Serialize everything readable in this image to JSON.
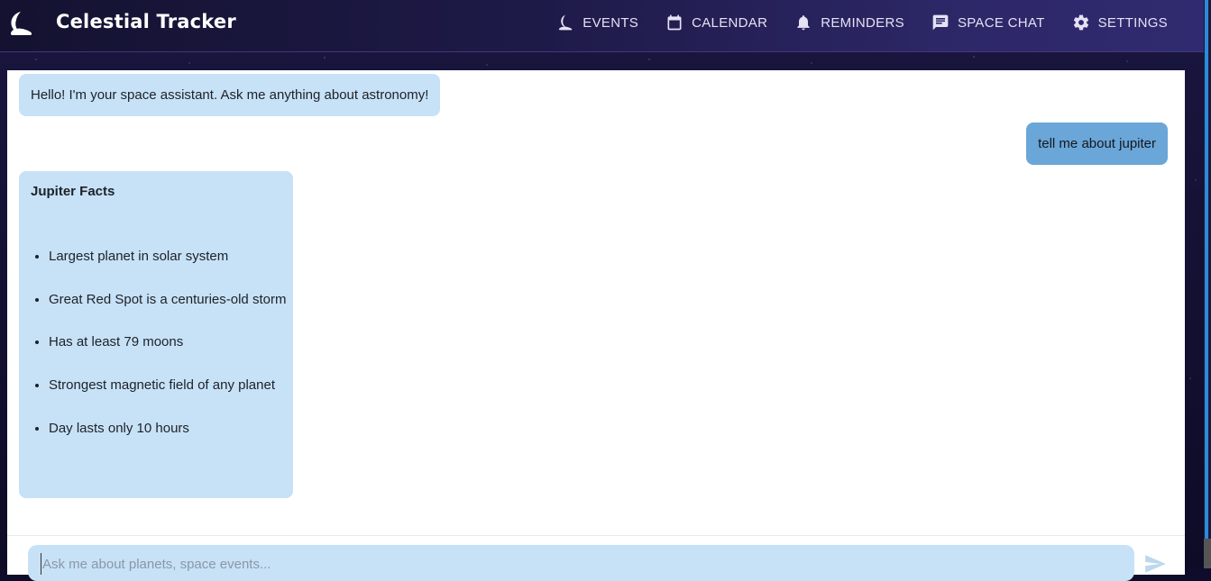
{
  "app": {
    "title": "Celestial Tracker"
  },
  "nav": [
    {
      "label": "EVENTS",
      "icon": "moon-icon"
    },
    {
      "label": "CALENDAR",
      "icon": "calendar-icon"
    },
    {
      "label": "REMINDERS",
      "icon": "bell-icon"
    },
    {
      "label": "SPACE CHAT",
      "icon": "chat-icon"
    },
    {
      "label": "SETTINGS",
      "icon": "gear-icon"
    }
  ],
  "chat": {
    "greeting": "Hello! I'm your space assistant. Ask me anything about astronomy!",
    "user_message": "tell me about jupiter",
    "response": {
      "title": "Jupiter Facts",
      "facts": [
        "Largest planet in solar system",
        "Great Red Spot is a centuries-old storm",
        "Has at least 79 moons",
        "Strongest magnetic field of any planet",
        "Day lasts only 10 hours"
      ]
    },
    "input": {
      "value": "",
      "placeholder": "Ask me about planets, space events..."
    }
  },
  "colors": {
    "header_bg": "#1e1a48",
    "assistant_bubble": "#c7e2f7",
    "user_bubble": "#6aa6d8"
  }
}
